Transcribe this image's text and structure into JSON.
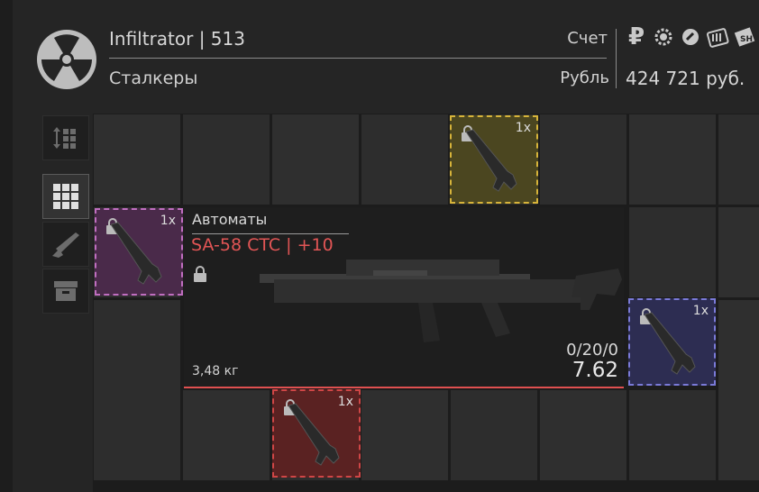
{
  "header": {
    "player_name": "Infiltrator | 513",
    "faction": "Сталкеры",
    "account_label": "Счет",
    "currency_label": "Рубль",
    "balance": "424 721 руб.",
    "currency_icons": [
      "ruble-icon",
      "gear-coin-icon",
      "bolt-coin-icon",
      "ammo-icon",
      "sh-voucher-icon"
    ],
    "currency_ruble_glyph": "₽"
  },
  "sidebar": {
    "tabs": [
      {
        "name": "sort-icon",
        "active": false
      },
      {
        "name": "grid-icon",
        "active": true
      },
      {
        "name": "rifle-icon",
        "active": false
      },
      {
        "name": "box-icon",
        "active": false
      }
    ]
  },
  "items": [
    {
      "id": "yellow",
      "qty": "1x",
      "rarity_color": "#d7b43a"
    },
    {
      "id": "purple",
      "qty": "1x",
      "rarity_color": "#c06ec0"
    },
    {
      "id": "blue",
      "qty": "1x",
      "rarity_color": "#7a7ad8"
    },
    {
      "id": "red",
      "qty": "1x",
      "rarity_color": "#d04646"
    }
  ],
  "selected": {
    "category": "Автоматы",
    "name": "SA-58 CTC | +10",
    "weight": "3,48 кг",
    "ammo": "0/20/0",
    "caliber": "7.62",
    "name_color": "#e25555"
  }
}
